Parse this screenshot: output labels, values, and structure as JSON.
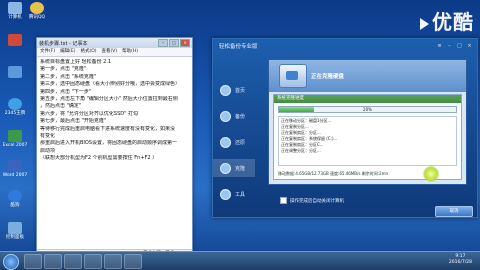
{
  "watermark": {
    "brand": "优酷"
  },
  "desktop_icons": [
    {
      "label": "计算机",
      "color": "#8ab7e8"
    },
    {
      "label": "腾讯QQ",
      "color": "#e8c24a"
    },
    {
      "label": "",
      "color": "#d04a3a"
    },
    {
      "label": "",
      "color": "#5a9ad8"
    },
    {
      "label": "2345王牌",
      "color": "#3fa0e6"
    },
    {
      "label": "Excel 2007",
      "color": "#3a9a4a"
    },
    {
      "label": "Word 2007",
      "color": "#3a64c0"
    },
    {
      "label": "酷狗",
      "color": "#2f7ae0"
    },
    {
      "label": "控制面板",
      "color": "#7aaee0"
    }
  ],
  "notepad": {
    "title": "装机步骤.txt - 记事本",
    "menu": [
      "文件(F)",
      "编辑(E)",
      "格式(O)",
      "查看(V)",
      "帮助(H)"
    ],
    "lines": [
      "系统目标盘置上好 轻松备份 2.1",
      "第一步，点击 \"克隆\"",
      "第二步，点击 \"系统克隆\"",
      "第三步，选中固态硬盘（看大小辨别好分哦，选中会变成绿色）",
      "第四步，点击 \"下一步\"",
      "第五步，点击左下角 \"编辑分区大小\" 然后大小位置拉到最右侧",
      "，然后点击 \"确定\"",
      "第六步，将 \"允许分区对齐以优化SSD\" 打勾",
      "第七步，最后点击 \"开始克隆\"",
      "等待移行完成后重启电脑看下进系统速度有没有变化，如果没",
      "有变化",
      "那重启后进入开机BIOS设置，将固态硬盘的启动顺序调成第一",
      "启动项",
      "（联想大部分机型为F2  个别机型需要按住 Fn+F2 ）"
    ],
    "status": "第 14 行，第 5"
  },
  "app": {
    "title": "轻松备份专业版",
    "nav": [
      {
        "label": "首页",
        "active": false
      },
      {
        "label": "备份",
        "active": false
      },
      {
        "label": "还原",
        "active": false
      },
      {
        "label": "克隆",
        "active": true
      },
      {
        "label": "工具",
        "active": false
      }
    ],
    "dialog": {
      "header_title": "正在克隆硬盘",
      "section_title": "系统克隆进度",
      "progress": {
        "percent": 20,
        "label": "20%"
      },
      "log": [
        "正在移动分区：磁盘1分区...",
        "正在复制分区...",
        "正在复制扇区：分区...",
        "正在复制扇区：系统保留 (C:)...",
        "正在复制扇区：分区C...",
        "正在调整分区：分区..."
      ],
      "stats": "移动数据:4.65GB/12.73GB  速度:65.46MB/s  剩余时间:2mn"
    },
    "footer": {
      "checkbox_label": "操作完成后自动关闭计算机",
      "cancel_label": "取消"
    }
  },
  "taskbar": {
    "time": "9:17",
    "date": "2016/7/28"
  }
}
